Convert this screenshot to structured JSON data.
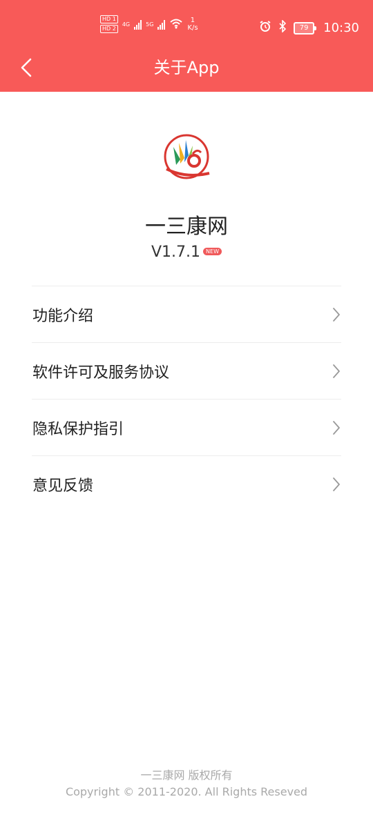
{
  "status_bar": {
    "hd1": "HD 1",
    "hd2": "HD 2",
    "net1": "4G",
    "net2": "5G",
    "speed_value": "1",
    "speed_unit": "K/s",
    "battery": "79",
    "time": "10:30"
  },
  "nav": {
    "title": "关于App"
  },
  "app": {
    "name": "一三康网",
    "version": "V1.7.1",
    "badge": "NEW"
  },
  "menu": {
    "items": [
      {
        "label": "功能介绍"
      },
      {
        "label": "软件许可及服务协议"
      },
      {
        "label": "隐私保护指引"
      },
      {
        "label": "意见反馈"
      }
    ]
  },
  "footer": {
    "line1": "一三康网 版权所有",
    "line2": "Copyright © 2011-2020. All Rights Reseved"
  },
  "colors": {
    "accent": "#f85a58",
    "text": "#222222",
    "muted": "#a9a9a9"
  }
}
